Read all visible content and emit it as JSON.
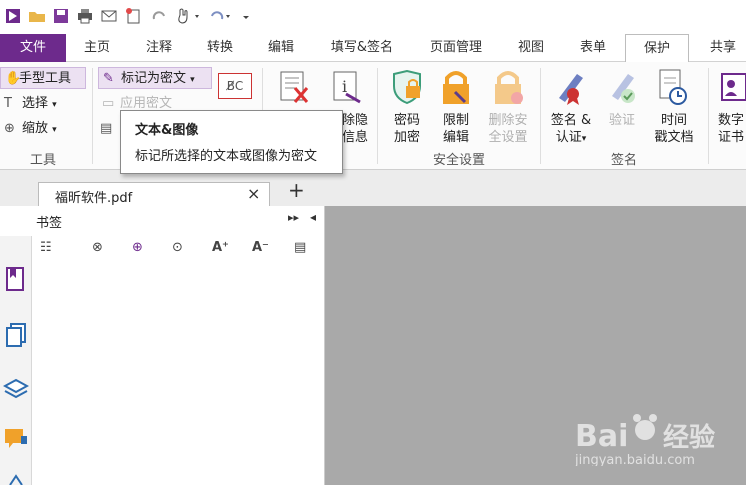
{
  "ribbon_tabs": {
    "file": "文件",
    "home": "主页",
    "comment": "注释",
    "convert": "转换",
    "edit": "编辑",
    "fill_sign": "填写&签名",
    "organize": "页面管理",
    "view": "视图",
    "form": "表单",
    "protect": "保护",
    "share": "共享"
  },
  "tools_group": {
    "hand_tool": "手型工具",
    "select": "选择",
    "zoom": "缩放",
    "label": "工具"
  },
  "redact_group": {
    "mark_redaction": "标记为密文",
    "apply_redaction": "应用密文",
    "remove_hidden_1": "除隐",
    "remove_hidden_2": "信息"
  },
  "security_group": {
    "password_1": "密码",
    "password_2": "加密",
    "restrict_1": "限制",
    "restrict_2": "编辑",
    "remove_sec_1": "删除安",
    "remove_sec_2": "全设置",
    "label": "安全设置"
  },
  "sign_group": {
    "sign_1": "签名 &",
    "sign_2": "认证",
    "verify": "验证",
    "timestamp_1": "时间",
    "timestamp_2": "戳文档",
    "label": "签名"
  },
  "cert_group": {
    "cert_1": "数字",
    "cert_2": "证书"
  },
  "tooltip": {
    "title": "文本&图像",
    "description": "标记所选择的文本或图像为密文"
  },
  "document": {
    "tab_name": "福昕软件.pdf",
    "close": "×",
    "new_tab": "+"
  },
  "bookmark_panel": {
    "title": "书签",
    "expand": "▸▸",
    "collapse": "◂"
  },
  "colors": {
    "accent": "#6d2a8c",
    "tab_file_bg": "#6d2a8c",
    "workspace_gray": "#a9a9a9"
  }
}
